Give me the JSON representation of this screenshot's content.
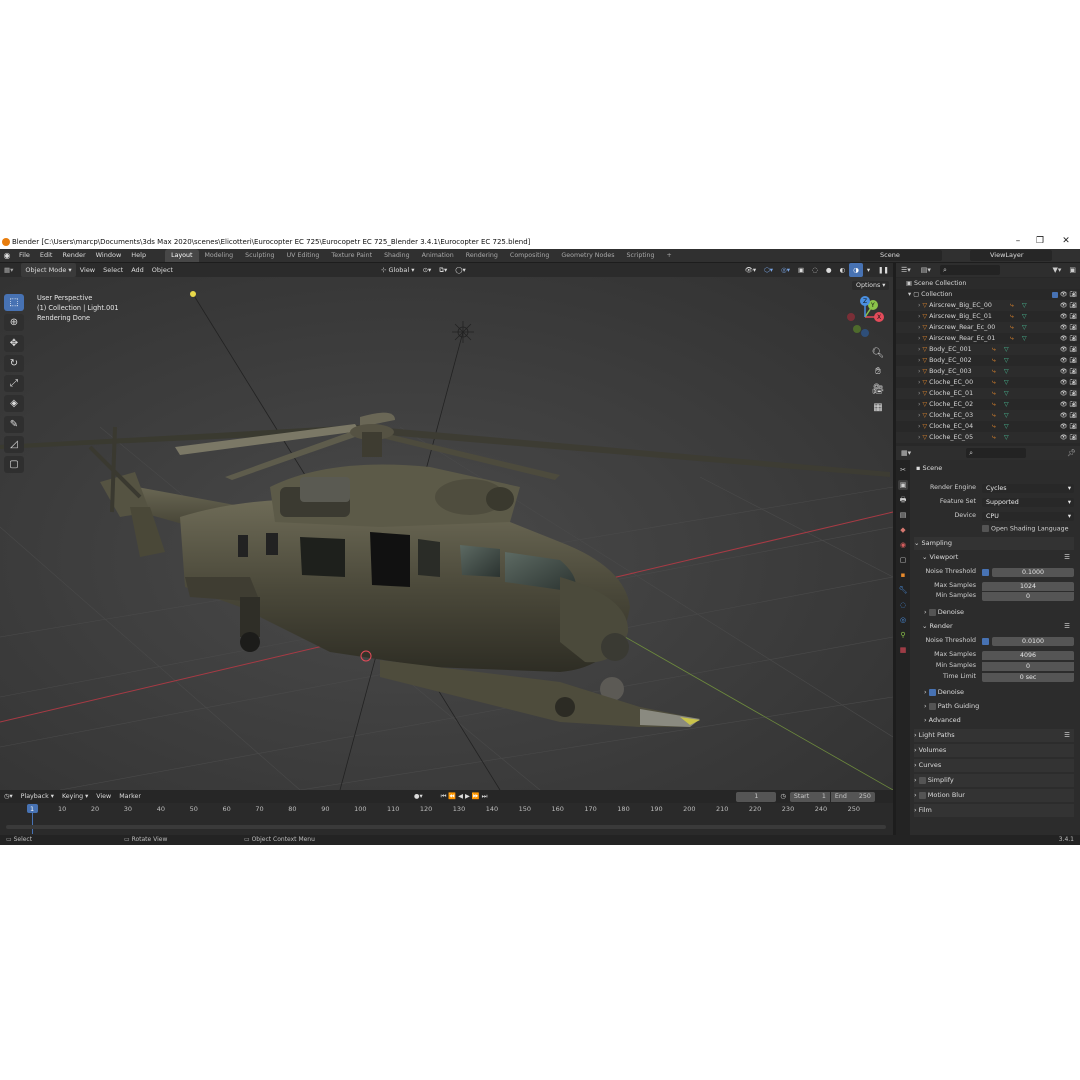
{
  "window": {
    "title": "Blender [C:\\Users\\marcp\\Documents\\3ds Max 2020\\scenes\\Elicotteri\\Eurocopter EC 725\\Eurocopetr EC 725_Blender 3.4.1\\Eurocopter EC 725.blend]",
    "minimize": "–",
    "maximize": "❐",
    "close": "✕"
  },
  "menu": {
    "items": [
      "File",
      "Edit",
      "Render",
      "Window",
      "Help"
    ],
    "workspaces": [
      "Layout",
      "Modeling",
      "Sculpting",
      "UV Editing",
      "Texture Paint",
      "Shading",
      "Animation",
      "Rendering",
      "Compositing",
      "Geometry Nodes",
      "Scripting"
    ],
    "add_tab": "+",
    "scene": "Scene",
    "view_layer": "ViewLayer"
  },
  "viewport_header": {
    "mode": "Object Mode",
    "menus": [
      "View",
      "Select",
      "Add",
      "Object"
    ],
    "transform_orientation": "Global",
    "options": "Options"
  },
  "viewport_overlay": {
    "line1": "User Perspective",
    "line2": "(1) Collection | Light.001",
    "line3": "Rendering Done"
  },
  "gizmo": {
    "x": "X",
    "y": "Y",
    "z": "Z"
  },
  "outliner": {
    "scene_collection": "Scene Collection",
    "collection": "Collection",
    "items": [
      "Airscrew_Big_EC_00",
      "Airscrew_Big_EC_01",
      "Airscrew_Rear_Ec_00",
      "Airscrew_Rear_Ec_01",
      "Body_EC_001",
      "Body_EC_002",
      "Body_EC_003",
      "Cloche_EC_00",
      "Cloche_EC_01",
      "Cloche_EC_02",
      "Cloche_EC_03",
      "Cloche_EC_04",
      "Cloche_EC_05"
    ]
  },
  "properties": {
    "context": "Scene",
    "render_engine_label": "Render Engine",
    "render_engine": "Cycles",
    "feature_set_label": "Feature Set",
    "feature_set": "Supported",
    "device_label": "Device",
    "device": "CPU",
    "osl": "Open Shading Language",
    "sampling": "Sampling",
    "viewport": "Viewport",
    "vp_noise_threshold_label": "Noise Threshold",
    "vp_noise_threshold": "0.1000",
    "vp_max_samples_label": "Max Samples",
    "vp_max_samples": "1024",
    "vp_min_samples_label": "Min Samples",
    "vp_min_samples": "0",
    "vp_denoise": "Denoise",
    "render": "Render",
    "r_noise_threshold_label": "Noise Threshold",
    "r_noise_threshold": "0.0100",
    "r_max_samples_label": "Max Samples",
    "r_max_samples": "4096",
    "r_min_samples_label": "Min Samples",
    "r_min_samples": "0",
    "r_time_limit_label": "Time Limit",
    "r_time_limit": "0 sec",
    "r_denoise": "Denoise",
    "path_guiding": "Path Guiding",
    "advanced": "Advanced",
    "light_paths": "Light Paths",
    "volumes": "Volumes",
    "curves": "Curves",
    "simplify": "Simplify",
    "motion_blur": "Motion Blur",
    "film": "Film"
  },
  "timeline": {
    "menus": [
      "Playback",
      "Keying",
      "View",
      "Marker"
    ],
    "current_frame": "1",
    "start_label": "Start",
    "start": "1",
    "end_label": "End",
    "end": "250",
    "ticks": [
      "1",
      "10",
      "20",
      "30",
      "40",
      "50",
      "60",
      "70",
      "80",
      "90",
      "100",
      "110",
      "120",
      "130",
      "140",
      "150",
      "160",
      "170",
      "180",
      "190",
      "200",
      "210",
      "220",
      "230",
      "240",
      "250"
    ]
  },
  "status": {
    "select": "Select",
    "rotate": "Rotate View",
    "context_menu": "Object Context Menu",
    "version": "3.4.1"
  },
  "colors": {
    "accent": "#4772b3",
    "x_axis": "#e44b5a",
    "y_axis": "#8bc34a",
    "z_axis": "#4a90e2",
    "object_icon": "#e88a2c",
    "mesh_icon": "#4ac29a"
  }
}
